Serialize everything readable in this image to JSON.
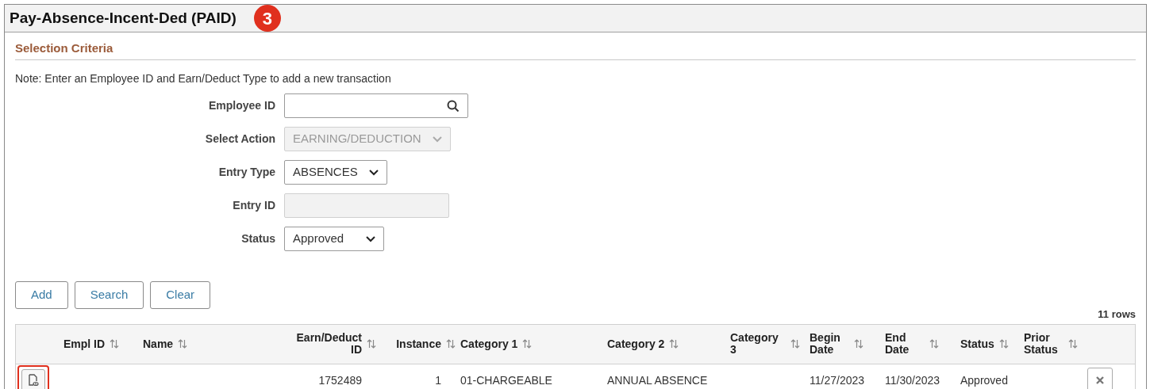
{
  "page": {
    "title": "Pay-Absence-Incent-Ded (PAID)",
    "callout": "3"
  },
  "section": {
    "title": "Selection Criteria",
    "note": "Note: Enter an Employee ID and Earn/Deduct Type to add a new transaction"
  },
  "fields": [
    {
      "label": "Employee ID",
      "kind": "lookup",
      "disabled": false
    },
    {
      "label": "Select Action",
      "kind": "select",
      "value": "EARNING/DEDUCTION",
      "disabled": true
    },
    {
      "label": "Entry Type",
      "kind": "select",
      "value": "ABSENCES",
      "disabled": false
    },
    {
      "label": "Entry ID",
      "kind": "text",
      "disabled": true
    },
    {
      "label": "Status",
      "kind": "select",
      "value": "Approved",
      "disabled": false
    }
  ],
  "buttons": [
    "Add",
    "Search",
    "Clear"
  ],
  "table": {
    "row_count": "11 rows",
    "columns": [
      "Empl ID",
      "Name",
      "Earn/Deduct ID",
      "Instance",
      "Category 1",
      "Category 2",
      "Category 3",
      "Begin Date",
      "End Date",
      "Status",
      "Prior Status"
    ],
    "rows": [
      {
        "highlighted": true,
        "cells": [
          null,
          null,
          "1752489",
          "1",
          "01-CHARGEABLE",
          "ANNUAL ABSENCE",
          null,
          "11/27/2023",
          "11/30/2023",
          "Approved",
          null
        ]
      }
    ]
  }
}
